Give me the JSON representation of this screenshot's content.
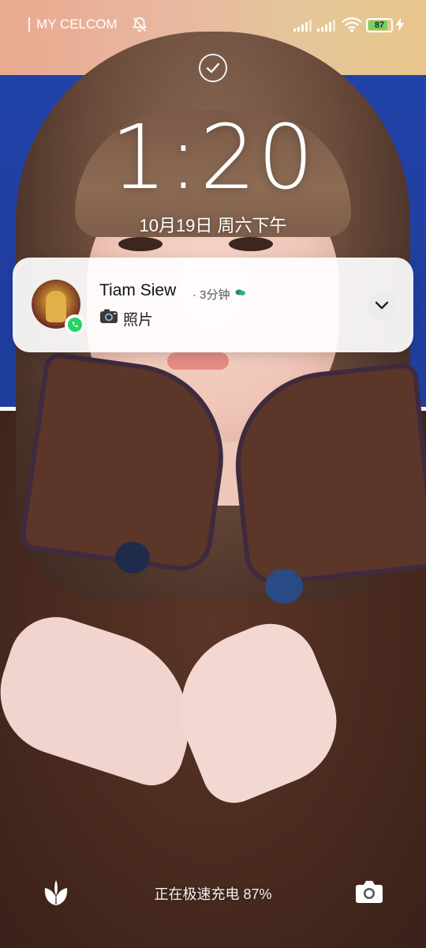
{
  "status_bar": {
    "carrier": "MY CELCOM",
    "battery_percent": 87,
    "battery_label": "87",
    "icons": [
      "bell-off-icon",
      "signal-icon",
      "signal-icon",
      "wifi-icon",
      "battery-icon",
      "charging-bolt-icon"
    ]
  },
  "lock_screen": {
    "time": "1:20",
    "date": "10月19日 周六下午"
  },
  "notification": {
    "sender": "Tiam Siew",
    "time_ago": "· 3分钟",
    "message_prefix_icon": "camera-emoji-icon",
    "message": "照片",
    "app_icon": "whatsapp-icon",
    "expand_icon": "chevron-down-icon",
    "accent_color": "#25d366"
  },
  "bottom_bar": {
    "charging_text": "正在极速充电 87%",
    "left_icon": "plant-icon",
    "right_icon": "camera-icon"
  }
}
